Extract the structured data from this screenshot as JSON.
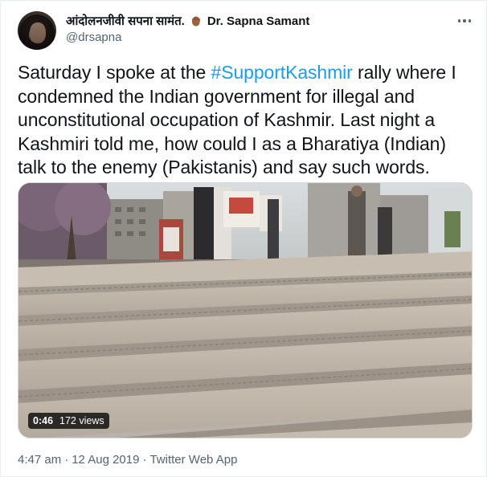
{
  "author": {
    "display_name_hindi": "आंदोलनजीवी सपना सामंत.",
    "display_name_english": "Dr. Sapna Samant",
    "handle": "@drsapna",
    "emoji_icon": "raised-fist-icon"
  },
  "tweet": {
    "text_before": "Saturday I spoke at the ",
    "hashtag": "#SupportKashmir",
    "text_after": " rally where I condemned the Indian government for illegal and unconstitutional occupation of Kashmir. Last night a Kashmiri told me, how could I as a Bharatiya (Indian) talk to the enemy (Pakistanis) and say such words."
  },
  "media": {
    "type": "video",
    "duration": "0:46",
    "views": "172 views"
  },
  "meta": {
    "time": "4:47 am",
    "separator": "·",
    "date": "12 Aug 2019",
    "source": "Twitter Web App"
  },
  "colors": {
    "link": "#1d9bf0",
    "secondary_text": "#536471",
    "primary_text": "#0f1419"
  }
}
